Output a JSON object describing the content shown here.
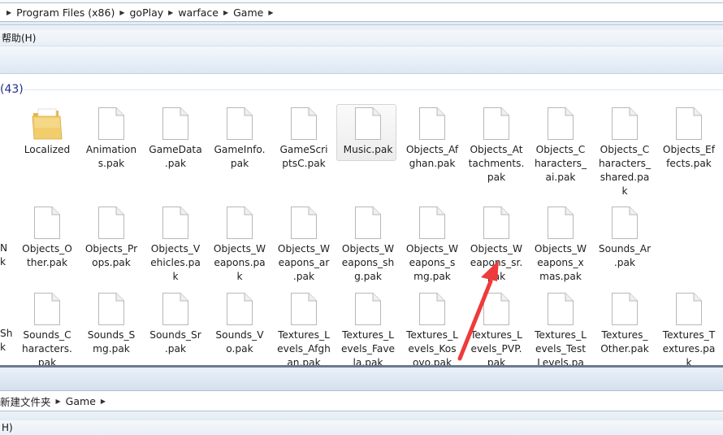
{
  "breadcrumb": {
    "items": [
      "Program Files (x86)",
      "goPlay",
      "warface",
      "Game"
    ]
  },
  "menu": {
    "help": "帮助(H)"
  },
  "group": {
    "count": "(43)"
  },
  "files": [
    {
      "name": "Localized",
      "lines": [
        "Localized"
      ],
      "type": "folder"
    },
    {
      "name": "Animations.pak",
      "lines": [
        "Animation",
        "s.pak"
      ],
      "type": "file"
    },
    {
      "name": "GameData.pak",
      "lines": [
        "GameData",
        ".pak"
      ],
      "type": "file"
    },
    {
      "name": "GameInfo.pak",
      "lines": [
        "GameInfo.",
        "pak"
      ],
      "type": "file"
    },
    {
      "name": "GameScriptsC.pak",
      "lines": [
        "GameScri",
        "ptsC.pak"
      ],
      "type": "file"
    },
    {
      "name": "Music.pak",
      "lines": [
        "Music.pak"
      ],
      "type": "file",
      "selected": true
    },
    {
      "name": "Objects_Afghan.pak",
      "lines": [
        "Objects_Af",
        "ghan.pak"
      ],
      "type": "file"
    },
    {
      "name": "Objects_Attachments.pak",
      "lines": [
        "Objects_At",
        "tachments.",
        "pak"
      ],
      "type": "file"
    },
    {
      "name": "Objects_Characters_ai.pak",
      "lines": [
        "Objects_C",
        "haracters_",
        "ai.pak"
      ],
      "type": "file"
    },
    {
      "name": "Objects_Characters_shared.pak",
      "lines": [
        "Objects_C",
        "haracters_",
        "shared.pa",
        "k"
      ],
      "type": "file"
    },
    {
      "name": "Objects_Effects.pak",
      "lines": [
        "Objects_Ef",
        "fects.pak"
      ],
      "type": "file"
    },
    {
      "name": "Objects_Other.pak",
      "lines": [
        "Objects_O",
        "ther.pak"
      ],
      "type": "file"
    },
    {
      "name": "Objects_Props.pak",
      "lines": [
        "Objects_Pr",
        "ops.pak"
      ],
      "type": "file"
    },
    {
      "name": "Objects_Vehicles.pak",
      "lines": [
        "Objects_V",
        "ehicles.pa",
        "k"
      ],
      "type": "file"
    },
    {
      "name": "Objects_Weapons.pak",
      "lines": [
        "Objects_W",
        "eapons.pa",
        "k"
      ],
      "type": "file"
    },
    {
      "name": "Objects_Weapons_ar.pak",
      "lines": [
        "Objects_W",
        "eapons_ar",
        ".pak"
      ],
      "type": "file"
    },
    {
      "name": "Objects_Weapons_shg.pak",
      "lines": [
        "Objects_W",
        "eapons_sh",
        "g.pak"
      ],
      "type": "file"
    },
    {
      "name": "Objects_Weapons_smg.pak",
      "lines": [
        "Objects_W",
        "eapons_s",
        "mg.pak"
      ],
      "type": "file"
    },
    {
      "name": "Objects_Weapons_sr.pak",
      "lines": [
        "Objects_W",
        "eapons_sr.",
        "pak"
      ],
      "type": "file"
    },
    {
      "name": "Objects_Weapons_xmas.pak",
      "lines": [
        "Objects_W",
        "eapons_x",
        "mas.pak"
      ],
      "type": "file"
    },
    {
      "name": "Sounds_Ar.pak",
      "lines": [
        "Sounds_Ar",
        ".pak"
      ],
      "type": "file"
    },
    {
      "name": "Sounds_Characters.pak",
      "lines": [
        "Sounds_C",
        "haracters.",
        "pak"
      ],
      "type": "file"
    },
    {
      "name": "Sounds_Smg.pak",
      "lines": [
        "Sounds_S",
        "mg.pak"
      ],
      "type": "file"
    },
    {
      "name": "Sounds_Sr.pak",
      "lines": [
        "Sounds_Sr",
        ".pak"
      ],
      "type": "file"
    },
    {
      "name": "Sounds_Vo.pak",
      "lines": [
        "Sounds_V",
        "o.pak"
      ],
      "type": "file"
    },
    {
      "name": "Textures_Levels_Afghan.pak",
      "lines": [
        "Textures_L",
        "evels_Afgh",
        "an.pak"
      ],
      "type": "file"
    },
    {
      "name": "Textures_Levels_Favela.pak",
      "lines": [
        "Textures_L",
        "evels_Fave",
        "la.pak"
      ],
      "type": "file"
    },
    {
      "name": "Textures_Levels_Kosovo.pak",
      "lines": [
        "Textures_L",
        "evels_Kos",
        "ovo.pak"
      ],
      "type": "file"
    },
    {
      "name": "Textures_Levels_PVP.pak",
      "lines": [
        "Textures_L",
        "evels_PVP.",
        "pak"
      ],
      "type": "file"
    },
    {
      "name": "Textures_Levels_TestLevels.pak",
      "lines": [
        "Textures_L",
        "evels_Test",
        "Levels.pa"
      ],
      "type": "file"
    },
    {
      "name": "Textures_Other.pak",
      "lines": [
        "Textures_",
        "Other.pak"
      ],
      "type": "file"
    },
    {
      "name": "Textures_Textures.pak",
      "lines": [
        "Textures_T",
        "extures.pa",
        "k"
      ],
      "type": "file"
    }
  ],
  "edge_fragments": {
    "row2_line1": "N",
    "row2_line2": "k",
    "row3_line1": "Sh",
    "row3_line2": "k"
  },
  "lower_window": {
    "breadcrumb": [
      "新建文件夹",
      "Game"
    ],
    "menu_fragment": "H)"
  },
  "colors": {
    "annotation_arrow": "#ee3b3b",
    "group_header_text": "#1e3287",
    "folder": "#f1cd6c"
  }
}
